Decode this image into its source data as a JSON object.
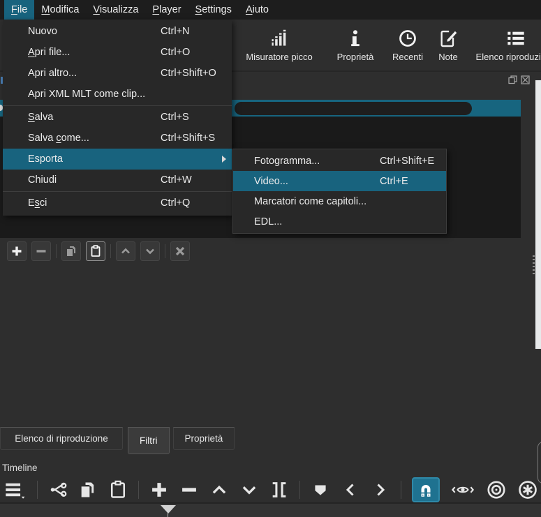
{
  "colors": {
    "accent_teal": "#17657f",
    "menu_highlight": "#18637e",
    "snap_button_teal": "#1f7290",
    "window_bg": "#2e2e2e",
    "dark_panel": "#1a1a1a"
  },
  "menu_bar": {
    "items": [
      {
        "pre": "",
        "u": "F",
        "post": "ile",
        "state": "open"
      },
      {
        "pre": "",
        "u": "M",
        "post": "odifica"
      },
      {
        "pre": "",
        "u": "V",
        "post": "isualizza"
      },
      {
        "pre": "",
        "u": "P",
        "post": "layer"
      },
      {
        "pre": "",
        "u": "S",
        "post": "ettings"
      },
      {
        "pre": "",
        "u": "A",
        "post": "iuto"
      }
    ]
  },
  "file_menu": {
    "items": [
      {
        "pre": "Nuovo",
        "u": "",
        "post": "",
        "shortcut": "Ctrl+N"
      },
      {
        "pre": "",
        "u": "A",
        "post": "pri file...",
        "shortcut": "Ctrl+O"
      },
      {
        "pre": "Apri altro...",
        "u": "",
        "post": "",
        "shortcut": "Ctrl+Shift+O"
      },
      {
        "pre": "Apri XML MLT come clip...",
        "u": "",
        "post": "",
        "shortcut": ""
      },
      {
        "pre": "",
        "u": "S",
        "post": "alva",
        "shortcut": "Ctrl+S"
      },
      {
        "pre": "Salva ",
        "u": "c",
        "post": "ome...",
        "shortcut": "Ctrl+Shift+S"
      },
      {
        "pre": "Esporta",
        "u": "",
        "post": "",
        "shortcut": "",
        "has_submenu": true,
        "highlighted": true
      },
      {
        "pre": "Chiudi",
        "u": "",
        "post": "",
        "shortcut": "Ctrl+W"
      },
      {
        "pre": "E",
        "u": "s",
        "post": "ci",
        "shortcut": "Ctrl+Q"
      }
    ]
  },
  "export_submenu": {
    "items": [
      {
        "label": "Fotogramma...",
        "shortcut": "Ctrl+Shift+E"
      },
      {
        "label": "Video...",
        "shortcut": "Ctrl+E",
        "highlighted": true
      },
      {
        "label": "Marcatori come capitoli...",
        "shortcut": ""
      },
      {
        "label": "EDL...",
        "shortcut": ""
      }
    ]
  },
  "top_toolbar": {
    "items": [
      {
        "label": "Misuratore picco",
        "icon": "peak-meter-icon"
      },
      {
        "label": "Proprietà",
        "icon": "info-icon"
      },
      {
        "label": "Recenti",
        "icon": "clock-icon"
      },
      {
        "label": "Note",
        "icon": "note-icon"
      },
      {
        "label": "Elenco riproduzione",
        "icon": "playlist-icon",
        "truncated": true
      }
    ]
  },
  "filters_panel": {
    "header_icons": [
      "float-icon",
      "close-icon"
    ],
    "selected_row": {
      "highlighted": true,
      "content": "redacted-pill"
    },
    "toolbar_icons": [
      "plus-icon",
      "minus-icon",
      "copy-icon",
      "paste-icon",
      "chevron-up-icon",
      "chevron-down-icon",
      "deselect-icon"
    ]
  },
  "bottom_tabs": {
    "items": [
      {
        "label": "Elenco di riproduzione"
      },
      {
        "label": "Filtri",
        "active": true
      },
      {
        "label": "Proprietà"
      }
    ]
  },
  "timeline": {
    "title": "Timeline",
    "toolbar_icons": [
      "timeline-menu-icon",
      "cut-icon",
      "copy-icon",
      "paste-icon",
      "append-icon",
      "ripple-delete-icon",
      "lift-icon",
      "overwrite-icon",
      "split-icon",
      "marker-icon",
      "prev-marker-icon",
      "next-marker-icon",
      "snap-icon",
      "scrub-icon",
      "ripple-icon",
      "ripple-all-icon",
      "ripple-markers-icon"
    ],
    "snap_active": true
  }
}
